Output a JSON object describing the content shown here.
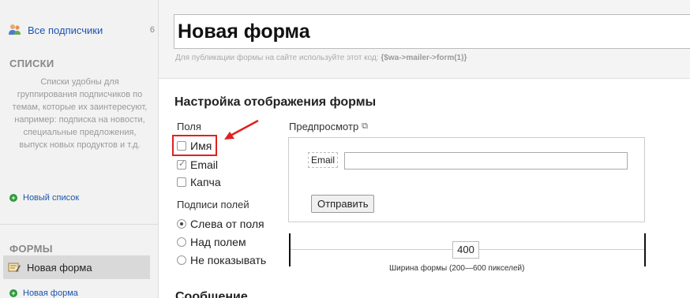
{
  "sidebar": {
    "all_subscribers": {
      "label": "Все подписчики",
      "count": "6"
    },
    "lists_heading": "СПИСКИ",
    "lists_description": "Списки удобны для группирования подписчиков по темам, которые их заинтересуют, например: подписка на новости, специальные предложения, выпуск новых продуктов и т.д.",
    "new_list_link": "Новый список",
    "forms_heading": "ФОРМЫ",
    "selected_form": "Новая форма",
    "new_form_link": "Новая форма"
  },
  "header": {
    "form_title": "Новая форма",
    "hint_text": "Для публикации формы на сайте используйте этот код:",
    "hint_code": "{$wa->mailer->form(1)}"
  },
  "main": {
    "section_title": "Настройка отображения формы",
    "fields_label": "Поля",
    "fields": [
      {
        "label": "Имя",
        "checked": false
      },
      {
        "label": "Email",
        "checked": true
      },
      {
        "label": "Капча",
        "checked": false
      }
    ],
    "field_labels_title": "Подписи полей",
    "label_positions": [
      {
        "label": "Слева от поля",
        "selected": true
      },
      {
        "label": "Над полем",
        "selected": false
      },
      {
        "label": "Не показывать",
        "selected": false
      }
    ],
    "preview_label": "Предпросмотр",
    "preview_email_label": "Email",
    "preview_submit": "Отправить",
    "form_width": "400",
    "width_caption": "Ширина формы (200—600 пикселей)",
    "cutoff_heading": "Сообщение"
  },
  "colors": {
    "link": "#1a55b0",
    "highlight": "#e02020",
    "add_icon": "#2e9a3a"
  }
}
